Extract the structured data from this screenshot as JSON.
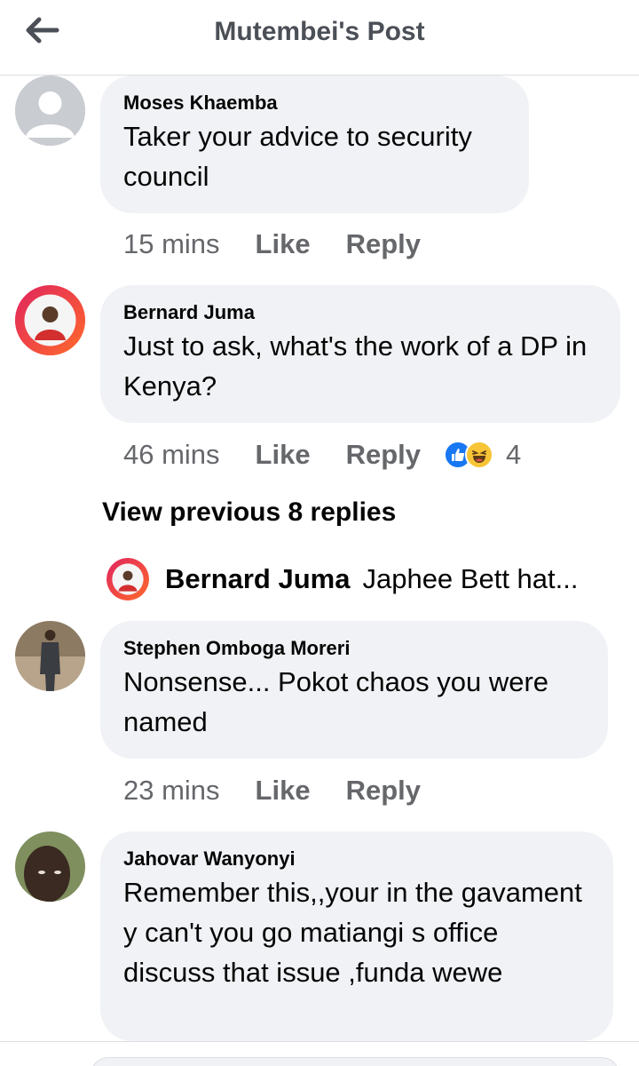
{
  "header": {
    "title": "Mutembei's Post"
  },
  "icons": {
    "back": "arrow-left-icon"
  },
  "comments": [
    {
      "author": "Moses Khaemba",
      "text": "Taker your advice to security council",
      "time": "15 mins",
      "like": "Like",
      "reply": "Reply"
    },
    {
      "author": "Bernard Juma",
      "text": "Just to ask, what's the work of a DP in Kenya?",
      "time": "46 mins",
      "like": "Like",
      "reply": "Reply",
      "reactions": {
        "icons": [
          "like-reaction-icon",
          "haha-reaction-icon"
        ],
        "count": "4"
      }
    },
    {
      "author": "Stephen Omboga Moreri",
      "text": "Nonsense... Pokot chaos you were named",
      "time": "23 mins",
      "like": "Like",
      "reply": "Reply"
    },
    {
      "author": "Jahovar Wanyonyi",
      "text": "Remember this,,your in the gavament y can't you go matiangi s office discuss that issue ,funda wewe"
    }
  ],
  "view_previous": "View previous 8 replies",
  "reply_preview": {
    "author": "Bernard Juma",
    "text": "Japhee Bett hat..."
  },
  "colors": {
    "bubble": "#f0f2f5",
    "meta_text": "#65676b",
    "like_blue": "#1877f2",
    "haha_yellow": "#f7c436"
  }
}
